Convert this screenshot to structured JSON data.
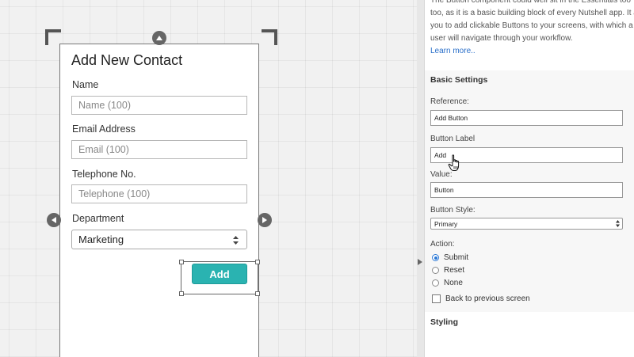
{
  "form": {
    "title": "Add New Contact",
    "fields": [
      {
        "label": "Name",
        "placeholder": "Name (100)"
      },
      {
        "label": "Email Address",
        "placeholder": "Email (100)"
      },
      {
        "label": "Telephone No.",
        "placeholder": "Telephone (100)"
      }
    ],
    "department": {
      "label": "Department",
      "value": "Marketing"
    },
    "button_label": "Add"
  },
  "panel": {
    "intro_lines": [
      "The Button component could well sit in the Essentials too",
      "too, as it is a basic building block of every Nutshell app. It a",
      "you to add clickable Buttons to your screens, with which a",
      "user will navigate through your workflow."
    ],
    "learn_more": "Learn more..",
    "basic_settings_heading": "Basic Settings",
    "reference": {
      "label": "Reference:",
      "value": "Add Button"
    },
    "button_label": {
      "label": "Button Label",
      "value": "Add"
    },
    "value": {
      "label": "Value:",
      "value": "Button"
    },
    "button_style": {
      "label": "Button Style:",
      "value": "Primary"
    },
    "action": {
      "label": "Action:",
      "options": [
        {
          "label": "Submit",
          "selected": true
        },
        {
          "label": "Reset",
          "selected": false
        },
        {
          "label": "None",
          "selected": false
        }
      ]
    },
    "back_checkbox": {
      "label": "Back to previous screen",
      "checked": false
    },
    "styling_heading": "Styling"
  },
  "colors": {
    "accent": "#2ab3b1",
    "link": "#2a6fc9",
    "radio_selected": "#2a78d6"
  },
  "icons": [
    "crop-corner-icon",
    "resize-handle-icon",
    "chevron-updown-icon",
    "collapse-arrow-icon",
    "hand-pointer-icon"
  ]
}
